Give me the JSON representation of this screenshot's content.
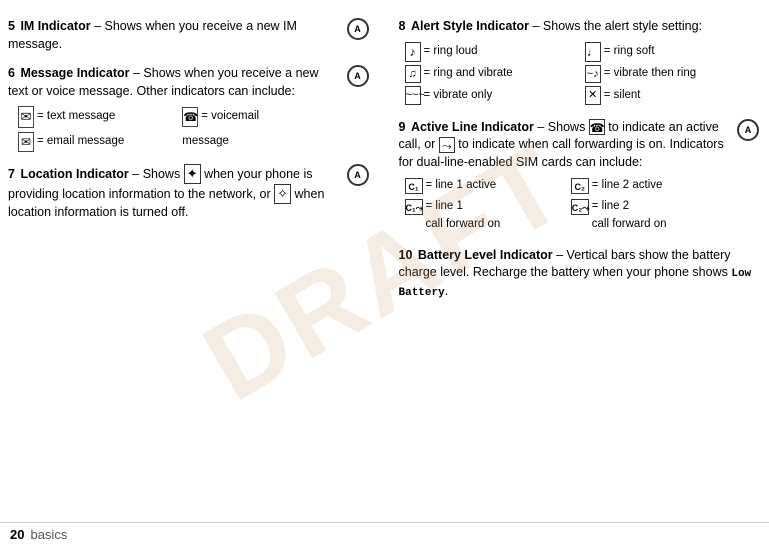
{
  "page": {
    "number": "20",
    "section_label": "basics",
    "draft_watermark": "DRAFT"
  },
  "sections_left": [
    {
      "id": "5",
      "title": "IM Indicator",
      "title_suffix": " – Shows when you receive a new IM message.",
      "has_nav_icon": true
    },
    {
      "id": "6",
      "title": "Message Indicator",
      "title_suffix": " – Shows when you receive a new text or voice message. Other indicators can include:",
      "has_nav_icon": true,
      "sub_items": [
        {
          "icon": "✉",
          "label": "= text message"
        },
        {
          "icon": "☎",
          "label": "= voicemail message"
        },
        {
          "icon": "📧",
          "label": "= email message"
        }
      ]
    },
    {
      "id": "7",
      "title": "Location Indicator",
      "title_suffix": " – Shows",
      "title_suffix2": " when your phone is providing location information to the network, or",
      "title_suffix3": " when location information is turned off.",
      "has_nav_icon": true
    }
  ],
  "sections_right": [
    {
      "id": "8",
      "title": "Alert Style Indicator",
      "title_suffix": " – Shows the alert style setting:",
      "sub_items": [
        {
          "icon": "🔔",
          "icon_char": "♪",
          "label": "= ring loud",
          "col": 1
        },
        {
          "icon": "🔔",
          "icon_char": "♩",
          "label": "= ring soft",
          "col": 2
        },
        {
          "icon": "📳",
          "icon_char": "♫~",
          "label": "= ring and vibrate",
          "col": 1
        },
        {
          "icon": "📳",
          "icon_char": "~♪",
          "label": "= vibrate then ring",
          "col": 2
        },
        {
          "icon": "📳",
          "icon_char": "~~~",
          "label": "= vibrate only",
          "col": 1
        },
        {
          "icon": "🔕",
          "icon_char": "✕",
          "label": "= silent",
          "col": 2
        }
      ]
    },
    {
      "id": "9",
      "title": "Active Line Indicator",
      "title_suffix": " – Shows",
      "title_suffix2": " to indicate an active call, or",
      "title_suffix3": " to indicate when call forwarding is on. Indicators for dual-line-enabled SIM cards can include:",
      "has_nav_icon": true,
      "sub_items": [
        {
          "icon_char": "C1",
          "label": "= line 1 active"
        },
        {
          "icon_char": "C2",
          "label": "= line 2 active"
        },
        {
          "icon_char": "CF1",
          "label": "= line 1\ncall forward on"
        },
        {
          "icon_char": "CF2",
          "label": "= line 2\ncall forward on"
        }
      ]
    },
    {
      "id": "10",
      "title": "Battery Level Indicator",
      "title_suffix": " – Vertical bars show the battery charge level. Recharge the battery when your phone shows",
      "mono_text": "Low Battery",
      "title_end": "."
    }
  ],
  "icons": {
    "nav_icon_label": "A",
    "ring_loud_symbol": "♪",
    "ring_soft_symbol": "♩",
    "ring_vibrate_symbol": "❧",
    "vibrate_then_ring_symbol": "~",
    "vibrate_only_symbol": "~",
    "silent_symbol": "✕",
    "text_msg_symbol": "✉",
    "voicemail_symbol": "☎",
    "email_symbol": "✉",
    "location_on_symbol": "✦",
    "location_off_symbol": "✧",
    "active_call_symbol": "☎",
    "call_forward_symbol": "⤳"
  }
}
